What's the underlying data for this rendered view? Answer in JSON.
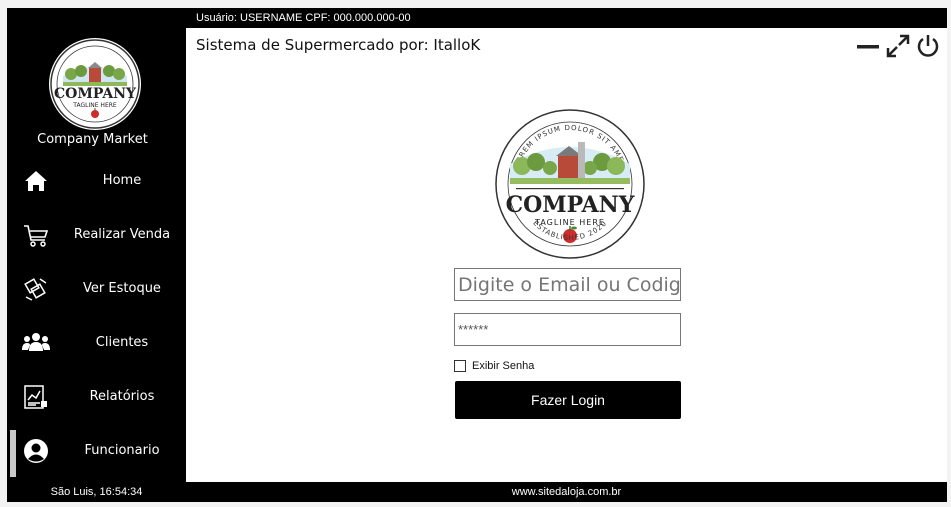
{
  "user_bar": {
    "text": "Usuário: USERNAME CPF: 000.000.000-00"
  },
  "app": {
    "title": "Sistema de Supermercado por: ItalloK"
  },
  "sidebar": {
    "company_name": "Company Market",
    "items": [
      {
        "label": "Home",
        "icon": "home-icon"
      },
      {
        "label": "Realizar Venda",
        "icon": "cart-icon"
      },
      {
        "label": "Ver Estoque",
        "icon": "inventory-icon"
      },
      {
        "label": "Clientes",
        "icon": "clients-icon"
      },
      {
        "label": "Relatórios",
        "icon": "report-icon"
      },
      {
        "label": "Funcionario",
        "icon": "user-icon"
      }
    ],
    "active_item": "Funcionario",
    "footer": "São Luis, 16:54:34"
  },
  "logo": {
    "arc_top": "LOREM IPSUM DOLOR SIT AMET",
    "company": "COMPANY",
    "tagline": "TAGLINE HERE",
    "established": "ESTABLISHED 2020"
  },
  "login": {
    "email_placeholder": "Digite o Email ou Codigo d",
    "password_value": "******",
    "show_password_label": "Exibir Senha",
    "button_label": "Fazer Login"
  },
  "footer": {
    "site": "www.sitedaloja.com.br"
  },
  "colors": {
    "background": "#000000",
    "content": "#ffffff",
    "active_bar": "#c9c9c9"
  }
}
